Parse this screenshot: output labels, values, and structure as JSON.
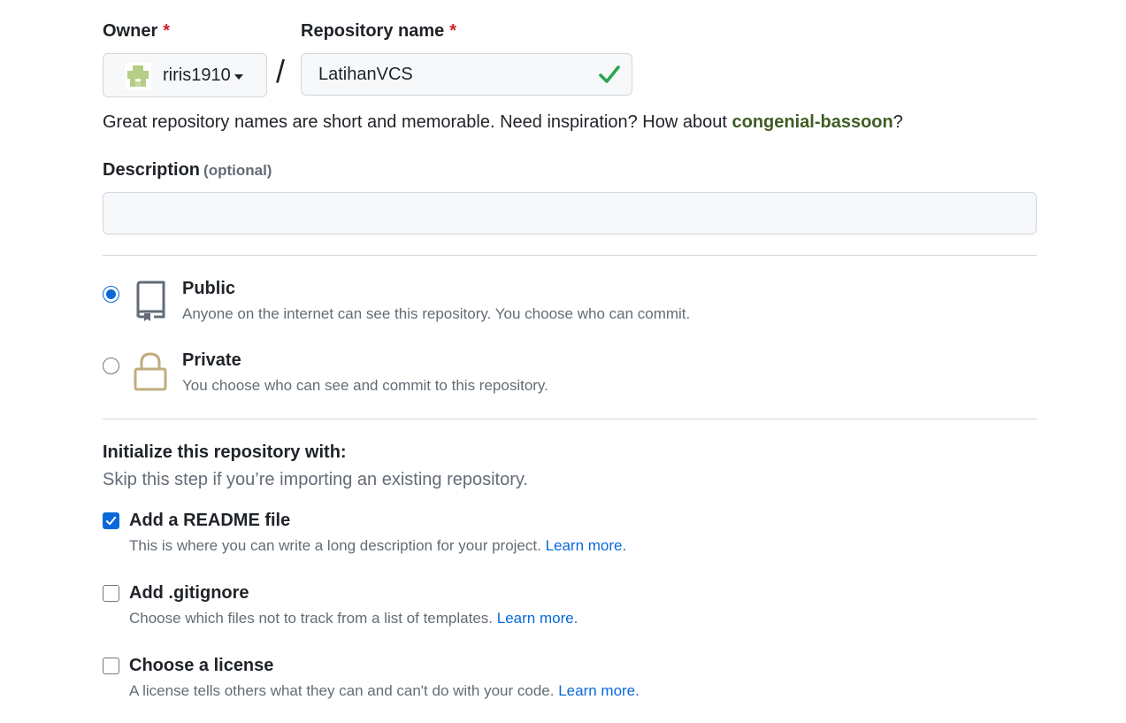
{
  "owner": {
    "label": "Owner",
    "required_mark": "*",
    "selected": "riris1910"
  },
  "repository": {
    "label": "Repository name",
    "required_mark": "*",
    "value": "LatihanVCS",
    "separator": "/"
  },
  "name_hint": {
    "prefix": "Great repository names are short and memorable. Need inspiration? How about ",
    "suggestion": "congenial-bassoon",
    "suffix": "?"
  },
  "description": {
    "label": "Description",
    "optional": "(optional)",
    "value": ""
  },
  "visibility": {
    "public": {
      "title": "Public",
      "subtitle": "Anyone on the internet can see this repository. You choose who can commit.",
      "selected": true
    },
    "private": {
      "title": "Private",
      "subtitle": "You choose who can see and commit to this repository.",
      "selected": false
    }
  },
  "initialize": {
    "title": "Initialize this repository with:",
    "subtitle": "Skip this step if you’re importing an existing repository.",
    "readme": {
      "title": "Add a README file",
      "subtitle": "This is where you can write a long description for your project.",
      "link": "Learn more.",
      "checked": true
    },
    "gitignore": {
      "title": "Add .gitignore",
      "subtitle": "Choose which files not to track from a list of templates.",
      "link": "Learn more.",
      "checked": false
    },
    "license": {
      "title": "Choose a license",
      "subtitle": "A license tells others what they can and can't do with your code.",
      "link": "Learn more.",
      "checked": false
    }
  },
  "colors": {
    "accent": "#0969da",
    "success": "#2da44e",
    "suggestion": "#3f5d22",
    "required": "#cf222e",
    "lock": "#bfac7e"
  }
}
